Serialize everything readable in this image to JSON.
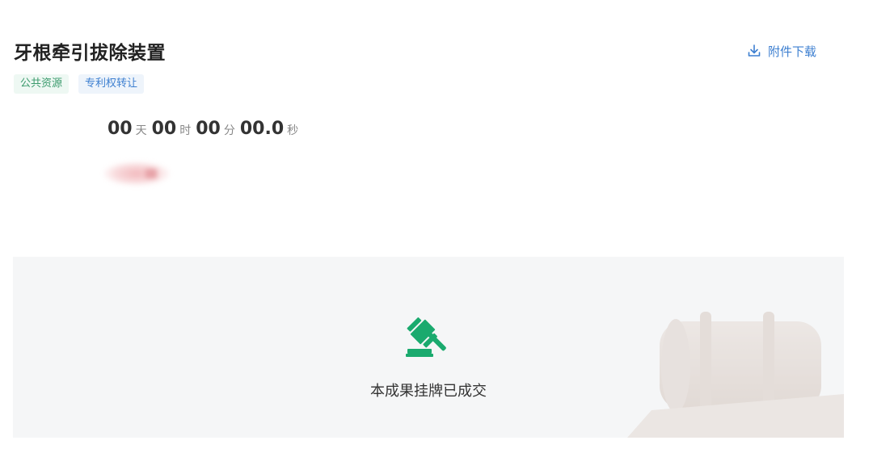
{
  "header": {
    "title": "牙根牵引拔除装置",
    "download_label": "附件下载"
  },
  "tags": [
    {
      "label": "公共资源",
      "color": "#3a9a6c"
    },
    {
      "label": "专利权转让",
      "color": "#3d7fd0"
    }
  ],
  "countdown": {
    "days": "00",
    "days_unit": "天",
    "hours": "00",
    "hours_unit": "时",
    "minutes": "00",
    "minutes_unit": "分",
    "seconds": "00.0",
    "seconds_unit": "秒"
  },
  "status": {
    "text": "本成果挂牌已成交",
    "icon": "gavel-icon",
    "icon_color": "#1aaa6e"
  },
  "colors": {
    "accent_blue": "#3d7fd0",
    "accent_green": "#1aaa6e",
    "panel_bg": "#f5f6f7"
  }
}
